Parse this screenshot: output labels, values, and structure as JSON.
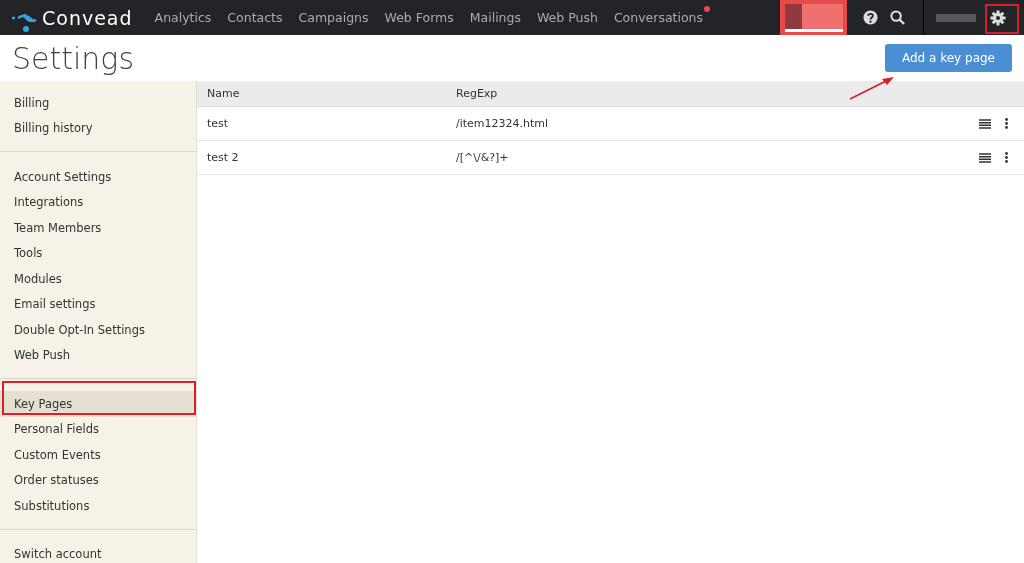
{
  "brand": "Convead",
  "nav": [
    {
      "label": "Analytics",
      "dot": false
    },
    {
      "label": "Contacts",
      "dot": false
    },
    {
      "label": "Campaigns",
      "dot": false
    },
    {
      "label": "Web Forms",
      "dot": false
    },
    {
      "label": "Mailings",
      "dot": false
    },
    {
      "label": "Web Push",
      "dot": false
    },
    {
      "label": "Conversations",
      "dot": true
    }
  ],
  "title": "Settings",
  "add_button": "Add a key page",
  "sidebar_groups": [
    [
      {
        "label": "Billing",
        "selected": false
      },
      {
        "label": "Billing history",
        "selected": false
      }
    ],
    [
      {
        "label": "Account Settings",
        "selected": false
      },
      {
        "label": "Integrations",
        "selected": false
      },
      {
        "label": "Team Members",
        "selected": false
      },
      {
        "label": "Tools",
        "selected": false
      },
      {
        "label": "Modules",
        "selected": false
      },
      {
        "label": "Email settings",
        "selected": false
      },
      {
        "label": "Double Opt-In Settings",
        "selected": false
      },
      {
        "label": "Web Push",
        "selected": false
      }
    ],
    [
      {
        "label": "Key Pages",
        "selected": true
      },
      {
        "label": "Personal Fields",
        "selected": false
      },
      {
        "label": "Custom Events",
        "selected": false
      },
      {
        "label": "Order statuses",
        "selected": false
      },
      {
        "label": "Substitutions",
        "selected": false
      }
    ],
    [
      {
        "label": "Switch account",
        "selected": false
      }
    ]
  ],
  "table": {
    "columns": [
      "Name",
      "RegExp"
    ],
    "rows": [
      {
        "name": "test",
        "regexp": "/item12324.html"
      },
      {
        "name": "test 2",
        "regexp": "/[^\\/&?]+"
      }
    ]
  }
}
